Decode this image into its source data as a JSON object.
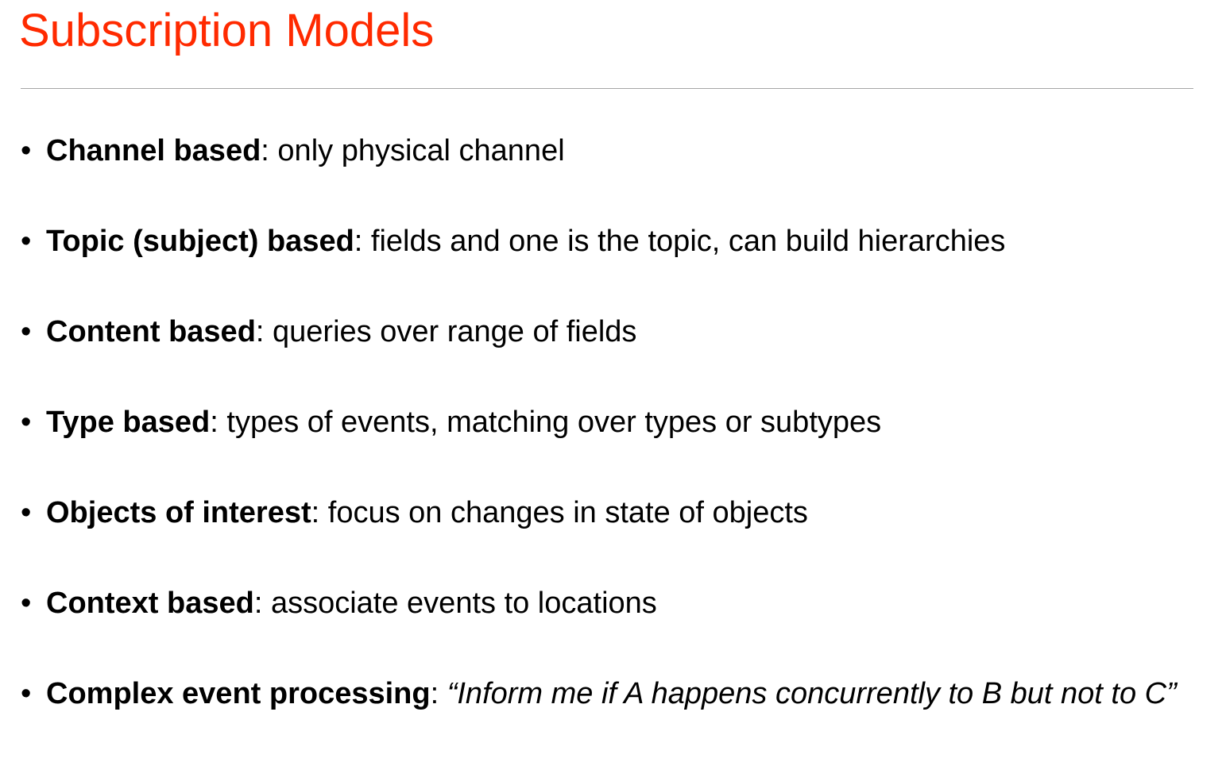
{
  "slide": {
    "title": "Subscription Models",
    "colors": {
      "title": "#ff2a00",
      "rule": "#a6a6a6",
      "text": "#000000"
    },
    "bullet_glyph": "•",
    "items": [
      {
        "term": "Channel based",
        "separator": ": ",
        "description": "only physical channel"
      },
      {
        "term": "Topic (subject) based",
        "separator": ": ",
        "description": "fields and one is the topic, can build hierarchies"
      },
      {
        "term": "Content based",
        "separator": ": ",
        "description": "queries over range of fields"
      },
      {
        "term": "Type based",
        "separator": ": ",
        "description": "types of events, matching over types or subtypes"
      },
      {
        "term": "Objects of interest",
        "separator": ": ",
        "description": "focus on changes in state of objects"
      },
      {
        "term": "Context based",
        "separator": ": ",
        "description": "associate events to locations"
      },
      {
        "term": "Complex event processing",
        "separator": ": ",
        "quote": "“Inform me if A happens concurrently to B but not to C”"
      }
    ]
  }
}
